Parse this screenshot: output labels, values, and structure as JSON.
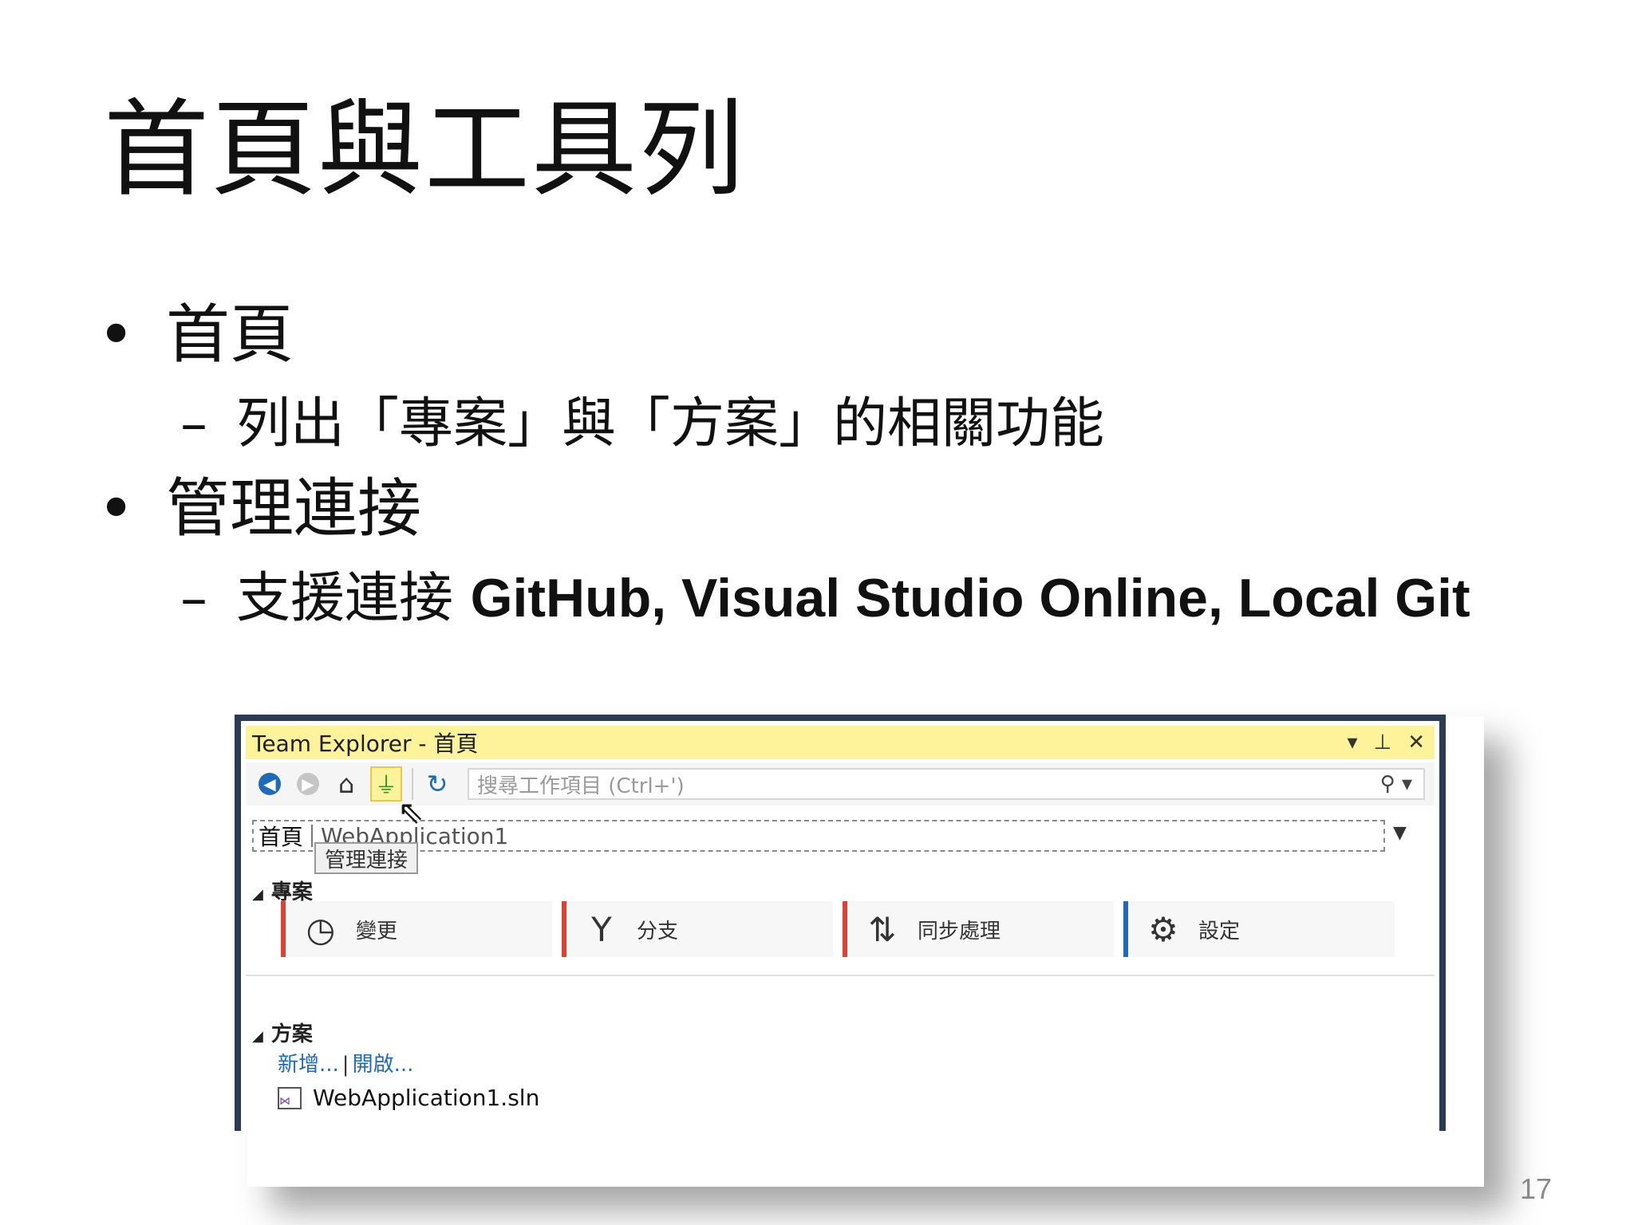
{
  "slide": {
    "title": "首頁與工具列",
    "bullets": [
      {
        "text": "首頁",
        "sub_dash": "–",
        "sub": "列出「專案」與「方案」的相關功能"
      },
      {
        "text": "管理連接",
        "sub_dash": "–",
        "sub_prefix": "支援連接 ",
        "sub_bold": "GitHub, Visual Studio Online, Local Git"
      }
    ],
    "page_number": "17"
  },
  "team_explorer": {
    "title": "Team Explorer - 首頁",
    "title_icons": {
      "dropdown": "▾",
      "pin": "⊥",
      "close": "✕"
    },
    "toolbar": {
      "back_icon": "back-arrow-icon",
      "forward_icon": "forward-arrow-icon",
      "home_icon": "home-icon",
      "connect_icon": "plug-icon",
      "refresh_icon": "refresh-icon"
    },
    "search_placeholder": "搜尋工作項目 (Ctrl+')",
    "nav": {
      "home": "首頁",
      "project": "WebApplication1"
    },
    "tooltip": "管理連接",
    "project_section": {
      "title": "專案",
      "tiles": [
        {
          "label": "變更",
          "icon": "clock-icon",
          "bar_color": "#d9432f"
        },
        {
          "label": "分支",
          "icon": "branch-icon",
          "bar_color": "#d9432f"
        },
        {
          "label": "同步處理",
          "icon": "sync-icon",
          "bar_color": "#d9432f"
        },
        {
          "label": "設定",
          "icon": "gear-icon",
          "bar_color": "#1e6ab8"
        }
      ]
    },
    "solution_section": {
      "title": "方案",
      "new_link": "新增...",
      "open_link": "開啟...",
      "solution_file": "WebApplication1.sln"
    }
  }
}
